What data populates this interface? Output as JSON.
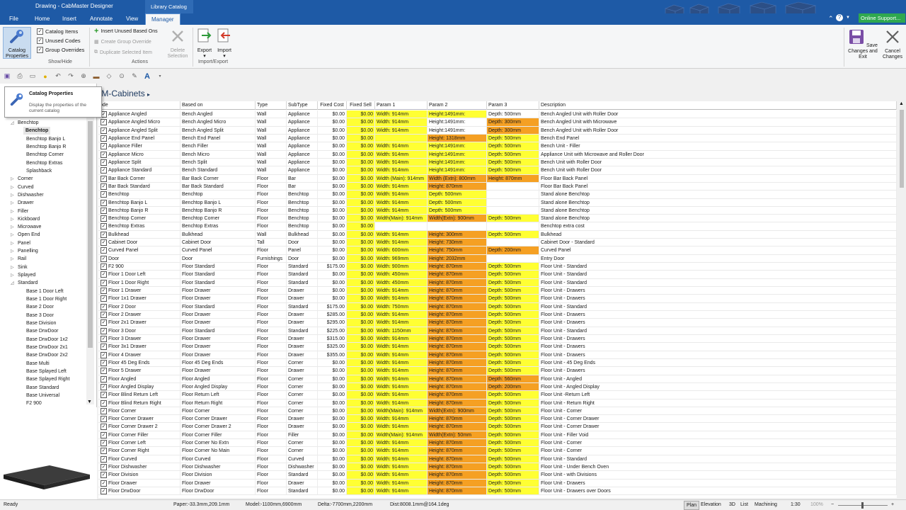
{
  "titlebar": {
    "title": "Drawing - CabMaster Designer",
    "context_tab": "Library Catalog",
    "online_support": "Online Support..."
  },
  "tabs": {
    "file": "File",
    "home": "Home",
    "insert": "Insert",
    "annotate": "Annotate",
    "view": "View",
    "manager": "Manager"
  },
  "ribbon": {
    "catalog_properties": "Catalog Properties",
    "show_hide": {
      "label": "Show/Hide",
      "items": [
        "Catalog Items",
        "Unused Codes",
        "Group Overrides"
      ]
    },
    "actions": {
      "label": "Actions",
      "insert_unused": "Insert Unused Based Ons",
      "create_group": "Create Group Override",
      "duplicate": "Duplicate Selected Item",
      "delete": "Delete Selection"
    },
    "import_export": {
      "label": "Import/Export",
      "export": "Export",
      "import": "Import"
    },
    "save": "Save Changes and Exit",
    "cancel": "Cancel Changes"
  },
  "tooltip": {
    "title": "Catalog Properties",
    "desc": "Display the properties of the current catalog"
  },
  "breadcrumb": "IM-Cabinets",
  "tree": [
    {
      "label": "Benchtop",
      "indent": 1,
      "exp": "◿"
    },
    {
      "label": "Benchtop",
      "indent": 2,
      "selected": true
    },
    {
      "label": "Benchtop Banjo L",
      "indent": 2
    },
    {
      "label": "Benchtop Banjo R",
      "indent": 2
    },
    {
      "label": "Benchtop Corner",
      "indent": 2
    },
    {
      "label": "Benchtop Extras",
      "indent": 2
    },
    {
      "label": "Splashback",
      "indent": 2
    },
    {
      "label": "Corner",
      "indent": 1,
      "exp": "▷"
    },
    {
      "label": "Curved",
      "indent": 1,
      "exp": "▷"
    },
    {
      "label": "Dishwasher",
      "indent": 1,
      "exp": "▷"
    },
    {
      "label": "Drawer",
      "indent": 1,
      "exp": "▷"
    },
    {
      "label": "Filler",
      "indent": 1,
      "exp": "▷"
    },
    {
      "label": "Kickboard",
      "indent": 1,
      "exp": "▷"
    },
    {
      "label": "Microwave",
      "indent": 1,
      "exp": "▷"
    },
    {
      "label": "Open End",
      "indent": 1,
      "exp": "▷"
    },
    {
      "label": "Panel",
      "indent": 1,
      "exp": "▷"
    },
    {
      "label": "Panelling",
      "indent": 1,
      "exp": "▷"
    },
    {
      "label": "Rail",
      "indent": 1,
      "exp": "▷"
    },
    {
      "label": "Sink",
      "indent": 1,
      "exp": "▷"
    },
    {
      "label": "Splayed",
      "indent": 1,
      "exp": "▷"
    },
    {
      "label": "Standard",
      "indent": 1,
      "exp": "◿"
    },
    {
      "label": "Base 1 Door Left",
      "indent": 2
    },
    {
      "label": "Base 1 Door Right",
      "indent": 2
    },
    {
      "label": "Base 2 Door",
      "indent": 2
    },
    {
      "label": "Base 3 Door",
      "indent": 2
    },
    {
      "label": "Base Division",
      "indent": 2
    },
    {
      "label": "Base DrwDoor",
      "indent": 2
    },
    {
      "label": "Base DrwDoor 1x2",
      "indent": 2
    },
    {
      "label": "Base DrwDoor 2x1",
      "indent": 2
    },
    {
      "label": "Base DrwDoor 2x2",
      "indent": 2
    },
    {
      "label": "Base Multi",
      "indent": 2
    },
    {
      "label": "Base Splayed Left",
      "indent": 2
    },
    {
      "label": "Base Splayed Right",
      "indent": 2
    },
    {
      "label": "Base Standard",
      "indent": 2
    },
    {
      "label": "Base Universal",
      "indent": 2
    },
    {
      "label": "F2 900",
      "indent": 2
    }
  ],
  "table": {
    "columns": [
      "ode",
      "Based on",
      "Type",
      "SubType",
      "Fixed Cost",
      "Fixed Sell",
      "Param 1",
      "Param 2",
      "Param 3",
      "Description"
    ],
    "rows": [
      [
        "Appliance Angled",
        "Bench Angled",
        "Wall",
        "Appliance",
        "$0.00",
        "$0.00",
        "Width: 914mm",
        "Height:1491mm:",
        "Depth: 500mm",
        "Bench Angled Unit with Roller Door",
        "yyyw"
      ],
      [
        "Appliance Angled Micro",
        "Bench Angled Micro",
        "Wall",
        "Appliance",
        "$0.00",
        "$0.00",
        "Width: 914mm",
        "Height:1491mm:",
        "Depth: 300mm",
        "Bench Angled Unit with Microwave",
        "yywo"
      ],
      [
        "Appliance Angled Split",
        "Bench Angled Split",
        "Wall",
        "Appliance",
        "$0.00",
        "$0.00",
        "Width: 914mm",
        "Height:1491mm:",
        "Depth: 300mm",
        "Bench Angled Unit with Roller Door",
        "yywo"
      ],
      [
        "Appliance End Panel",
        "Bench End Panel",
        "Wall",
        "Appliance",
        "$0.00",
        "$0.00",
        "",
        "Height: 1318mm",
        "Depth: 500mm",
        "Bench End Panel",
        "yyoy"
      ],
      [
        "Appliance Filler",
        "Bench Filler",
        "Wall",
        "Appliance",
        "$0.00",
        "$0.00",
        "Width: 914mm",
        "Height:1491mm:",
        "Depth: 500mm",
        "Bench Unit - Filler",
        "yyyy"
      ],
      [
        "Appliance Micro",
        "Bench Micro",
        "Wall",
        "Appliance",
        "$0.00",
        "$0.00",
        "Width: 914mm",
        "Height:1491mm:",
        "Depth: 500mm",
        "Appliance Unit with Microwave and Roller Door",
        "yyyy"
      ],
      [
        "Appliance Split",
        "Bench Split",
        "Wall",
        "Appliance",
        "$0.00",
        "$0.00",
        "Width: 914mm",
        "Height:1491mm:",
        "Depth: 500mm",
        "Bench Unit with Roller Door",
        "yyyy"
      ],
      [
        "Appliance Standard",
        "Bench Standard",
        "Wall",
        "Appliance",
        "$0.00",
        "$0.00",
        "Width: 914mm",
        "Height:1491mm:",
        "Depth: 500mm",
        "Bench Unit with Roller Door",
        "yyyy"
      ],
      [
        "Bar Back Corner",
        "Bar Back Corner",
        "Floor",
        "Bar",
        "$0.00",
        "$0.00",
        "Width (Main): 914mm",
        "Width (Extn): 800mm",
        "Height: 870mm",
        "Floor Bar Back Panel",
        "yyoo"
      ],
      [
        "Bar Back Standard",
        "Bar Back Standard",
        "Floor",
        "Bar",
        "$0.00",
        "$0.00",
        "Width: 914mm",
        "Height: 870mm",
        "",
        "Floor Bar Back Panel",
        "yyow"
      ],
      [
        "Benchtop",
        "Benchtop",
        "Floor",
        "Benchtop",
        "$0.00",
        "$0.00",
        "Width: 914mm",
        "Depth: 500mm",
        "",
        "Stand alone Benchtop",
        "yyyw"
      ],
      [
        "Benchtop Banjo L",
        "Benchtop Banjo L",
        "Floor",
        "Benchtop",
        "$0.00",
        "$0.00",
        "Width: 914mm",
        "Depth: 500mm",
        "",
        "Stand alone Benchtop",
        "yyyw"
      ],
      [
        "Benchtop Banjo R",
        "Benchtop Banjo R",
        "Floor",
        "Benchtop",
        "$0.00",
        "$0.00",
        "Width: 914mm",
        "Depth: 500mm",
        "",
        "Stand alone Benchtop",
        "yyyw"
      ],
      [
        "Benchtop Corner",
        "Benchtop Corner",
        "Floor",
        "Benchtop",
        "$0.00",
        "$0.00",
        "Width(Main): 914mm",
        "Width(Extn): 900mm",
        "Depth: 500mm",
        "Stand alone Benchtop",
        "yyoy"
      ],
      [
        "Benchtop Extras",
        "Benchtop Extras",
        "Floor",
        "Benchtop",
        "$0.00",
        "$0.00",
        "",
        "",
        "",
        "Benchtop extra cost",
        "ywww"
      ],
      [
        "Bulkhead",
        "Bulkhead",
        "Wall",
        "Bulkhead",
        "$0.00",
        "$0.00",
        "Width: 914mm",
        "Height: 300mm",
        "Depth: 500mm",
        "Bulkhead",
        "yyoy"
      ],
      [
        "Cabinet Door",
        "Cabinet Door",
        "Tall",
        "Door",
        "$0.00",
        "$0.00",
        "Width: 914mm",
        "Height: 730mm",
        "",
        "Cabinet Door - Standard",
        "yyow"
      ],
      [
        "Curved Panel",
        "Curved Panel",
        "Floor",
        "Panel",
        "$0.00",
        "$0.00",
        "Width: 600mm",
        "Height: 750mm",
        "Depth: 200mm",
        "Curved Panel",
        "yyoo"
      ],
      [
        "Door",
        "Door",
        "Furnishings",
        "Door",
        "$0.00",
        "$0.00",
        "Width: 969mm",
        "Height: 2032mm",
        "",
        "Entry Door",
        "yyow"
      ],
      [
        "F2 900",
        "Floor Standard",
        "Floor",
        "Standard",
        "$175.00",
        "$0.00",
        "Width: 900mm",
        "Height: 870mm",
        "Depth: 500mm",
        "Floor Unit - Standard",
        "yyoy"
      ],
      [
        "Floor 1 Door Left",
        "Floor Standard",
        "Floor",
        "Standard",
        "$0.00",
        "$0.00",
        "Width: 450mm",
        "Height: 870mm",
        "Depth: 500mm",
        "Floor Unit - Standard",
        "yyoy"
      ],
      [
        "Floor 1 Door Right",
        "Floor Standard",
        "Floor",
        "Standard",
        "$0.00",
        "$0.00",
        "Width: 450mm",
        "Height: 870mm",
        "Depth: 500mm",
        "Floor Unit - Standard",
        "yyoy"
      ],
      [
        "Floor 1 Drawer",
        "Floor Drawer",
        "Floor",
        "Drawer",
        "$0.00",
        "$0.00",
        "Width: 914mm",
        "Height: 870mm",
        "Depth: 500mm",
        "Floor Unit - Drawers",
        "yyoy"
      ],
      [
        "Floor 1x1 Drawer",
        "Floor Drawer",
        "Floor",
        "Drawer",
        "$0.00",
        "$0.00",
        "Width: 914mm",
        "Height: 870mm",
        "Depth: 500mm",
        "Floor Unit - Drawers",
        "yyoy"
      ],
      [
        "Floor 2 Door",
        "Floor Standard",
        "Floor",
        "Standard",
        "$175.00",
        "$0.00",
        "Width: 750mm",
        "Height: 870mm",
        "Depth: 500mm",
        "Floor Unit - Standard",
        "yyoy"
      ],
      [
        "Floor 2 Drawer",
        "Floor Drawer",
        "Floor",
        "Drawer",
        "$285.00",
        "$0.00",
        "Width: 914mm",
        "Height: 870mm",
        "Depth: 500mm",
        "Floor Unit - Drawers",
        "yyoy"
      ],
      [
        "Floor 2x1 Drawer",
        "Floor Drawer",
        "Floor",
        "Drawer",
        "$295.00",
        "$0.00",
        "Width: 914mm",
        "Height: 870mm",
        "Depth: 500mm",
        "Floor Unit - Drawers",
        "yyoy"
      ],
      [
        "Floor 3 Door",
        "Floor Standard",
        "Floor",
        "Standard",
        "$225.00",
        "$0.00",
        "Width: 1150mm",
        "Height: 870mm",
        "Depth: 500mm",
        "Floor Unit - Standard",
        "yyoy"
      ],
      [
        "Floor 3 Drawer",
        "Floor Drawer",
        "Floor",
        "Drawer",
        "$315.00",
        "$0.00",
        "Width: 914mm",
        "Height: 870mm",
        "Depth: 500mm",
        "Floor Unit - Drawers",
        "yyoy"
      ],
      [
        "Floor 3x1 Drawer",
        "Floor Drawer",
        "Floor",
        "Drawer",
        "$325.00",
        "$0.00",
        "Width: 914mm",
        "Height: 870mm",
        "Depth: 500mm",
        "Floor Unit - Drawers",
        "yyoy"
      ],
      [
        "Floor 4 Drawer",
        "Floor Drawer",
        "Floor",
        "Drawer",
        "$355.00",
        "$0.00",
        "Width: 914mm",
        "Height: 870mm",
        "Depth: 500mm",
        "Floor Unit - Drawers",
        "yyoy"
      ],
      [
        "Floor 45 Deg Ends",
        "Floor 45 Deg Ends",
        "Floor",
        "Corner",
        "$0.00",
        "$0.00",
        "Width: 914mm",
        "Height: 870mm",
        "Depth: 500mm",
        "Floor Unit - 45 Deg Ends",
        "yyoy"
      ],
      [
        "Floor 5 Drawer",
        "Floor Drawer",
        "Floor",
        "Drawer",
        "$0.00",
        "$0.00",
        "Width: 914mm",
        "Height: 870mm",
        "Depth: 500mm",
        "Floor Unit - Drawers",
        "yyoy"
      ],
      [
        "Floor Angled",
        "Floor Angled",
        "Floor",
        "Corner",
        "$0.00",
        "$0.00",
        "Width: 914mm",
        "Height: 870mm",
        "Depth: 560mm",
        "Floor Unit - Angled",
        "yyoo"
      ],
      [
        "Floor Angled Display",
        "Floor Angled Display",
        "Floor",
        "Corner",
        "$0.00",
        "$0.00",
        "Width: 914mm",
        "Height: 870mm",
        "Depth: 200mm",
        "Floor Unit - Angled Display",
        "yyoo"
      ],
      [
        "Floor Blind Return Left",
        "Floor Return Left",
        "Floor",
        "Corner",
        "$0.00",
        "$0.00",
        "Width: 914mm",
        "Height: 870mm",
        "Depth: 500mm",
        "Floor Unit -Return Left",
        "yyoy"
      ],
      [
        "Floor Blind Return Right",
        "Floor Return Right",
        "Floor",
        "Corner",
        "$0.00",
        "$0.00",
        "Width: 914mm",
        "Height: 870mm",
        "Depth: 500mm",
        "Floor Unit - Return Right",
        "yyoy"
      ],
      [
        "Floor Corner",
        "Floor Corner",
        "Floor",
        "Corner",
        "$0.00",
        "$0.00",
        "Width(Main): 914mm",
        "Width(Extn): 900mm",
        "Depth: 500mm",
        "Floor Unit - Corner",
        "yyoy"
      ],
      [
        "Floor Corner Drawer",
        "Floor Corner Drawer",
        "Floor",
        "Drawer",
        "$0.00",
        "$0.00",
        "Width: 914mm",
        "Height: 870mm",
        "Depth: 500mm",
        "Floor Unit - Corner Drawer",
        "yyoy"
      ],
      [
        "Floor Corner Drawer 2",
        "Floor Corner Drawer 2",
        "Floor",
        "Drawer",
        "$0.00",
        "$0.00",
        "Width: 914mm",
        "Height: 870mm",
        "Depth: 500mm",
        "Floor Unit - Corner Drawer",
        "yyoy"
      ],
      [
        "Floor Corner Filler",
        "Floor Corner Filler",
        "Floor",
        "Filler",
        "$0.00",
        "$0.00",
        "Width(Main): 914mm",
        "Width(Extn): 50mm",
        "Depth: 500mm",
        "Floor Unit - Filler Void",
        "yyoy"
      ],
      [
        "Floor Corner Left",
        "Floor Corner No Extn",
        "Floor",
        "Corner",
        "$0.00",
        "$0.00",
        "Width: 914mm",
        "Height: 870mm",
        "Depth: 500mm",
        "Floor Unit - Corner",
        "yyoy"
      ],
      [
        "Floor Corner Right",
        "Floor Corner No Main",
        "Floor",
        "Corner",
        "$0.00",
        "$0.00",
        "Width: 914mm",
        "Height: 870mm",
        "Depth: 500mm",
        "Floor Unit - Corner",
        "yyoy"
      ],
      [
        "Floor Curved",
        "Floor Curved",
        "Floor",
        "Curved",
        "$0.00",
        "$0.00",
        "Width: 914mm",
        "Height: 870mm",
        "Depth: 500mm",
        "Floor Unit - Standard",
        "yyoy"
      ],
      [
        "Floor Dishwasher",
        "Floor Dishwasher",
        "Floor",
        "Dishwasher",
        "$0.00",
        "$0.00",
        "Width: 914mm",
        "Height: 870mm",
        "Depth: 500mm",
        "Floor Unit - Under Bench Oven",
        "yyoy"
      ],
      [
        "Floor Division",
        "Floor Division",
        "Floor",
        "Standard",
        "$0.00",
        "$0.00",
        "Width: 914mm",
        "Height: 870mm",
        "Depth: 500mm",
        "Floor Unit - with Divisions",
        "yyoy"
      ],
      [
        "Floor Drawer",
        "Floor Drawer",
        "Floor",
        "Drawer",
        "$0.00",
        "$0.00",
        "Width: 914mm",
        "Height: 870mm",
        "Depth: 500mm",
        "Floor Unit - Drawers",
        "yyoy"
      ],
      [
        "Floor DrwDoor",
        "Floor DrwDoor",
        "Floor",
        "Standard",
        "$0.00",
        "$0.00",
        "Width: 914mm",
        "Height: 870mm",
        "Depth: 500mm",
        "Floor Unit - Drawers over Doors",
        "yyoy"
      ]
    ]
  },
  "status": {
    "ready": "Ready",
    "paper": "Paper:-33.3mm,209.1mm",
    "model": "Model:-1100mm,6900mm",
    "delta": "Delta:-7700mm,2200mm",
    "dist": "Dist:8008.1mm@164.1deg",
    "tabs": [
      "Plan",
      "Elevation",
      "3D",
      "List",
      "Machining"
    ],
    "scale": "1:30",
    "zoom": "100%"
  },
  "colors": {
    "accent": "#1e5aa6",
    "yellow": "#ffff33",
    "orange": "#f5a023",
    "online": "#2fa84f"
  }
}
